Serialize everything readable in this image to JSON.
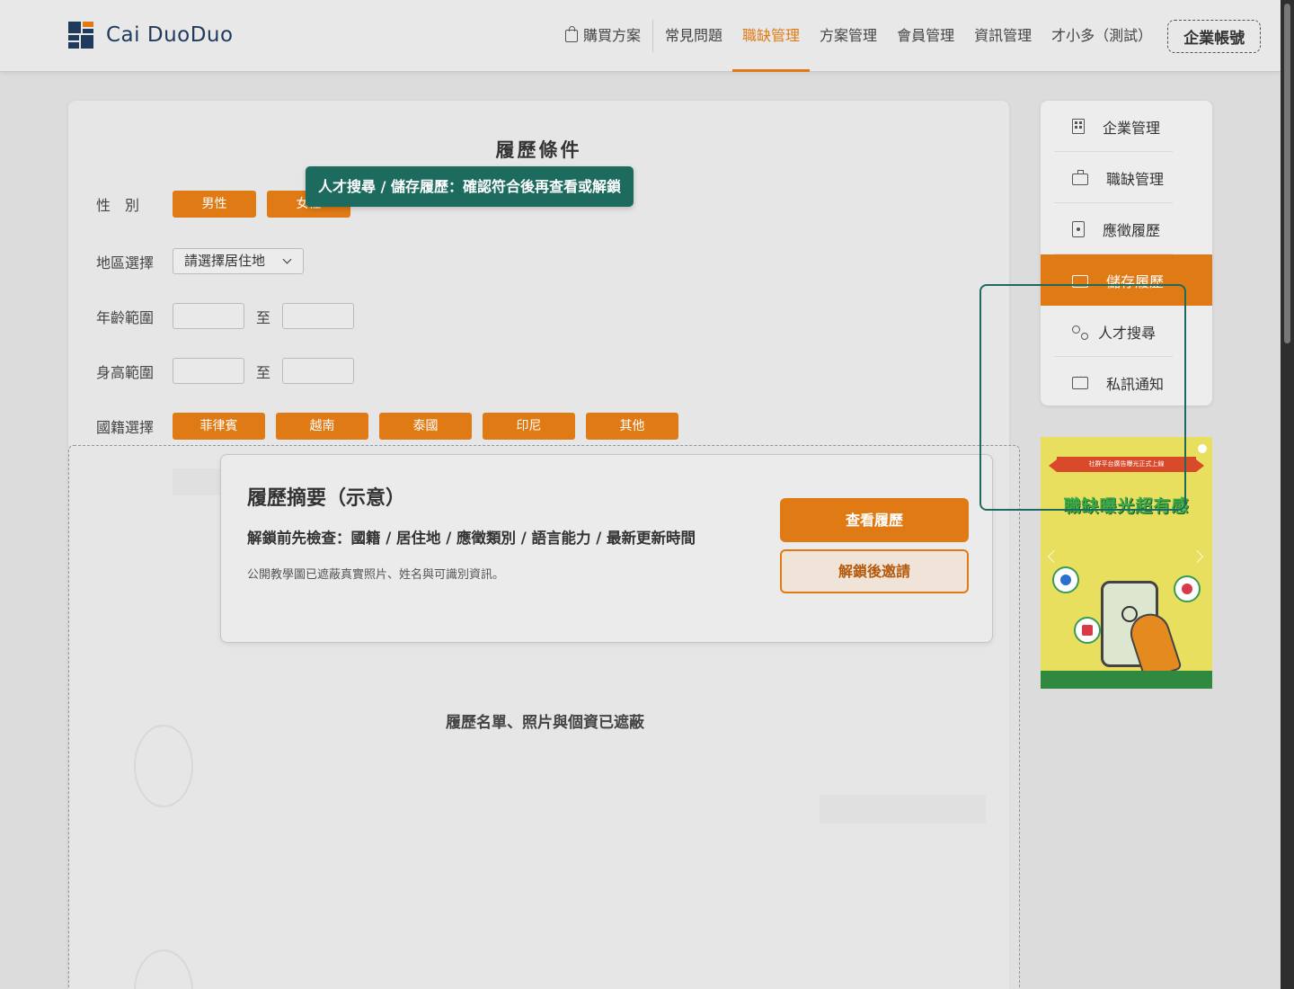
{
  "header": {
    "logo_text": "Cai DuoDuo",
    "nav": [
      {
        "label": "購買方案",
        "icon": "shopping-bag-icon"
      },
      {
        "label": "常見問題"
      },
      {
        "label": "職缺管理",
        "active": true
      },
      {
        "label": "方案管理"
      },
      {
        "label": "會員管理"
      },
      {
        "label": "資訊管理"
      },
      {
        "label": "才小多（測試）"
      }
    ],
    "account_button": "企業帳號"
  },
  "filters": {
    "title": "履歷條件",
    "gender": {
      "label": "性　別",
      "options": [
        "男性",
        "女性"
      ]
    },
    "region": {
      "label": "地區選擇",
      "placeholder": "請選擇居住地"
    },
    "age": {
      "label": "年齡範圍",
      "to": "至"
    },
    "height": {
      "label": "身高範圍",
      "to": "至"
    },
    "nationality": {
      "label": "國籍選擇",
      "options": [
        "菲律賓",
        "越南",
        "泰國",
        "印尼",
        "其他"
      ]
    }
  },
  "tooltip": "人才搜尋 / 儲存履歷：確認符合後再查看或解鎖",
  "summary": {
    "title": "履歷摘要（示意）",
    "check": "解鎖前先檢查：國籍 / 居住地 / 應徵類別 / 語言能力 / 最新更新時間",
    "note": "公開教學圖已遮蔽真實照片、姓名與可識別資訊。",
    "view_button": "查看履歷",
    "unlock_button": "解鎖後邀請"
  },
  "masked_caption": "履歷名單、照片與個資已遮蔽",
  "side_menu": [
    {
      "label": "企業管理",
      "icon": "building-icon"
    },
    {
      "label": "職缺管理",
      "icon": "briefcase-icon"
    },
    {
      "label": "應徵履歷",
      "icon": "resume-icon"
    },
    {
      "label": "儲存履歷",
      "icon": "folder-star-icon",
      "active": true
    },
    {
      "label": "人才搜尋",
      "icon": "user-search-icon"
    },
    {
      "label": "私訊通知",
      "icon": "chat-icon"
    }
  ],
  "banner": {
    "ribbon": "社群平台廣告曝光正式上線",
    "headline": "職缺曝光超有感"
  },
  "colors": {
    "accent": "#e07a14",
    "brand_navy": "#1f3a5c",
    "highlight": "#1d6b5f"
  }
}
